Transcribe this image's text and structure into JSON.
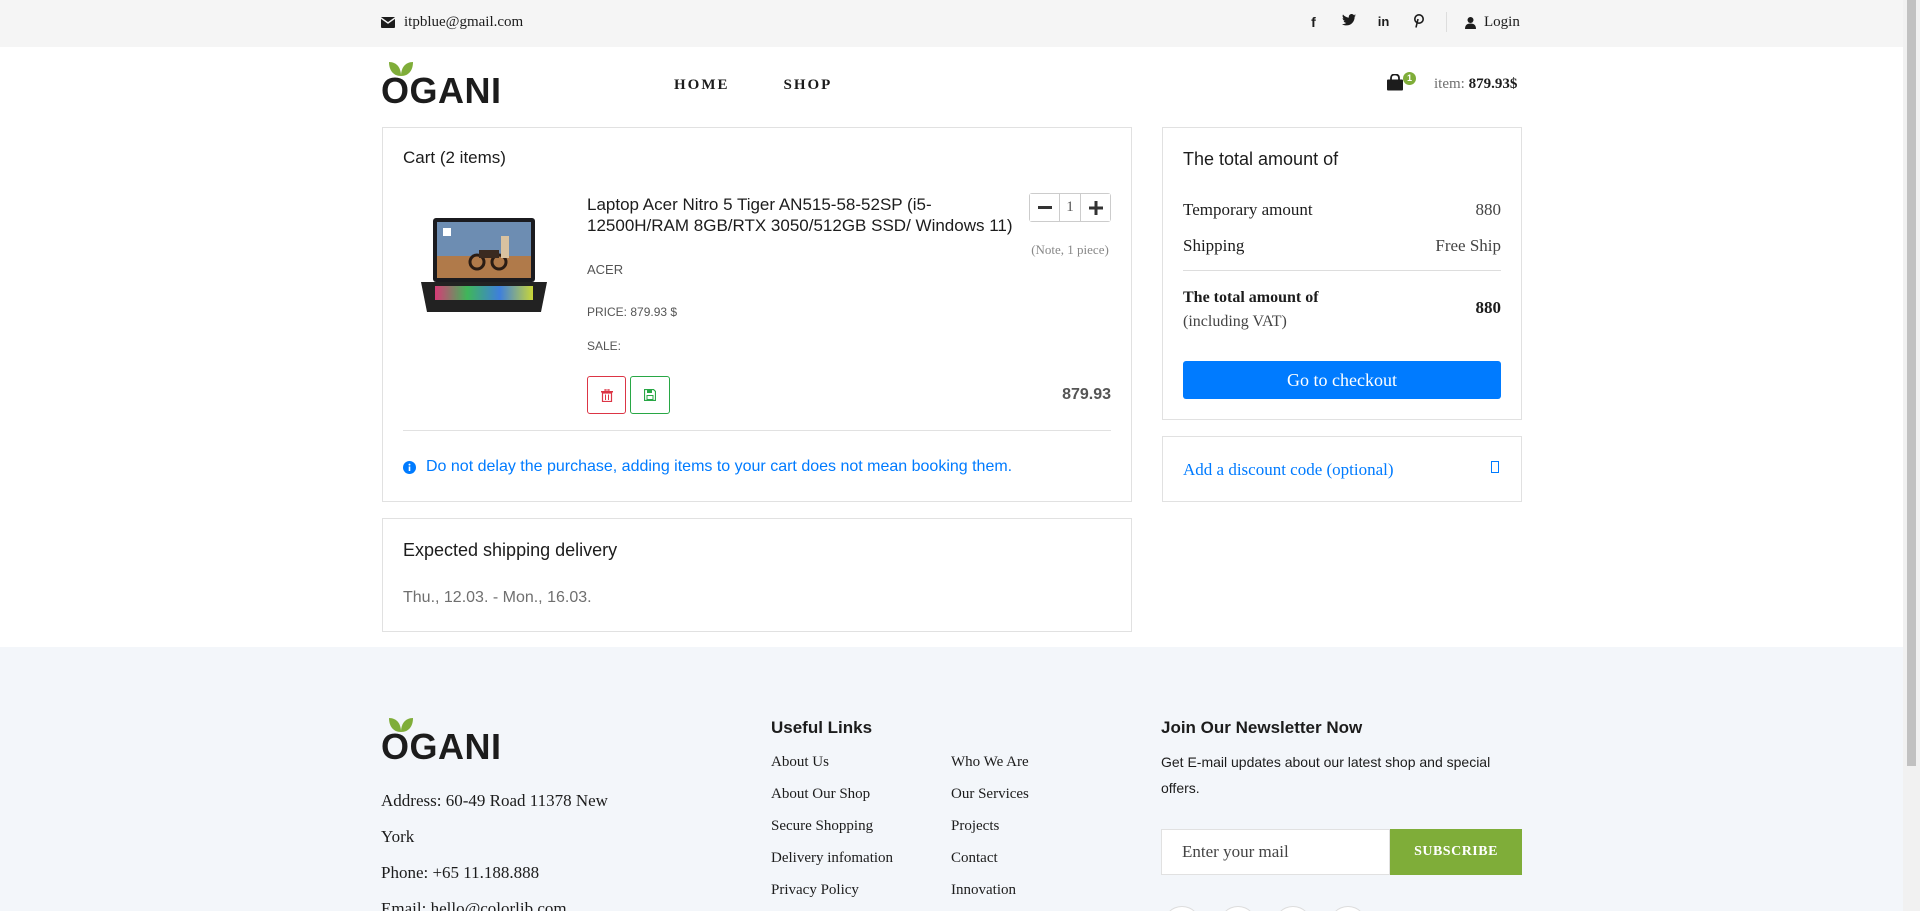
{
  "topbar": {
    "email": "itpblue@gmail.com",
    "socials": [
      "facebook-icon",
      "twitter-icon",
      "linkedin-icon",
      "pinterest-icon"
    ],
    "login": "Login"
  },
  "header": {
    "logo": "OGANI",
    "nav": [
      "HOME",
      "SHOP"
    ],
    "cart_count": "1",
    "cart_label": "item:",
    "cart_total": "879.93$"
  },
  "cart": {
    "title": "Cart (2 items)",
    "item": {
      "name": "Laptop Acer Nitro 5 Tiger AN515-58-52SP (i5-12500H/RAM 8GB/RTX 3050/512GB SSD/ Windows 11)",
      "brand": "ACER",
      "price": "PRICE: 879.93 $",
      "sale": "SALE:",
      "quantity": "1",
      "quantity_note": "(Note, 1 piece)",
      "line_total": "879.93"
    },
    "notice": "Do not delay the purchase, adding items to your cart does not mean booking them."
  },
  "shipping": {
    "title": "Expected shipping delivery",
    "dates": "Thu., 12.03. - Mon., 16.03."
  },
  "totals": {
    "title": "The total amount of",
    "temporary_label": "Temporary amount",
    "temporary_value": "880",
    "shipping_label": "Shipping",
    "shipping_value": "Free Ship",
    "final_label": "The total amount of",
    "final_sub": "(including VAT)",
    "final_value": "880",
    "checkout": "Go to checkout",
    "discount": "Add a discount code (optional)"
  },
  "footer": {
    "logo": "OGANI",
    "address_1": "Address: 60-49 Road 11378 New",
    "address_2": "York",
    "phone": "Phone: +65 11.188.888",
    "email": "Email: hello@colorlib.com",
    "useful_links_title": "Useful Links",
    "links_col1": [
      "About Us",
      "About Our Shop",
      "Secure Shopping",
      "Delivery infomation",
      "Privacy Policy"
    ],
    "links_col2": [
      "Who We Are",
      "Our Services",
      "Projects",
      "Contact",
      "Innovation"
    ],
    "newsletter_title": "Join Our Newsletter Now",
    "newsletter_text": "Get E-mail updates about our latest shop and special offers.",
    "newsletter_placeholder": "Enter your mail",
    "subscribe": "SUBSCRIBE"
  },
  "colors": {
    "accent_green": "#7fad39",
    "primary_blue": "#007bff",
    "danger_red": "#dc3545",
    "success_green": "#28a745"
  }
}
